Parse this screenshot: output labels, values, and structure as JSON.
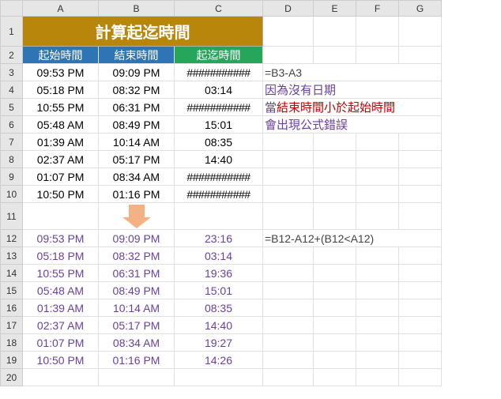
{
  "columns": [
    "",
    "A",
    "B",
    "C",
    "D",
    "E",
    "F",
    "G"
  ],
  "title": "計算起迄時間",
  "headers": {
    "start": "起始時間",
    "end": "結束時間",
    "elapsed": "起迄時間"
  },
  "rows_top": [
    {
      "n": 3,
      "a": "09:53 PM",
      "b": "09:09 PM",
      "c": "###########"
    },
    {
      "n": 4,
      "a": "05:18 PM",
      "b": "08:32 PM",
      "c": "03:14"
    },
    {
      "n": 5,
      "a": "10:55 PM",
      "b": "06:31 PM",
      "c": "###########"
    },
    {
      "n": 6,
      "a": "05:48 AM",
      "b": "08:49 PM",
      "c": "15:01"
    },
    {
      "n": 7,
      "a": "01:39 AM",
      "b": "10:14 AM",
      "c": "08:35"
    },
    {
      "n": 8,
      "a": "02:37 AM",
      "b": "05:17 PM",
      "c": "14:40"
    },
    {
      "n": 9,
      "a": "01:07 PM",
      "b": "08:34 AM",
      "c": "###########"
    },
    {
      "n": 10,
      "a": "10:50 PM",
      "b": "01:16 PM",
      "c": "###########"
    }
  ],
  "rows_bottom": [
    {
      "n": 12,
      "a": "09:53 PM",
      "b": "09:09 PM",
      "c": "23:16"
    },
    {
      "n": 13,
      "a": "05:18 PM",
      "b": "08:32 PM",
      "c": "03:14"
    },
    {
      "n": 14,
      "a": "10:55 PM",
      "b": "06:31 PM",
      "c": "19:36"
    },
    {
      "n": 15,
      "a": "05:48 AM",
      "b": "08:49 PM",
      "c": "15:01"
    },
    {
      "n": 16,
      "a": "01:39 AM",
      "b": "10:14 AM",
      "c": "08:35"
    },
    {
      "n": 17,
      "a": "02:37 AM",
      "b": "05:17 PM",
      "c": "14:40"
    },
    {
      "n": 18,
      "a": "01:07 PM",
      "b": "08:34 AM",
      "c": "19:27"
    },
    {
      "n": 19,
      "a": "10:50 PM",
      "b": "01:16 PM",
      "c": "14:26"
    }
  ],
  "formula_top": "=B3-A3",
  "formula_bottom": "=B12-A12+(B12<A12)",
  "notes": {
    "line1": "因為沒有日期",
    "line2a": "當",
    "line2b": "結束時間小於起始時間",
    "line3": "會出現公式錯誤"
  },
  "row11": 11,
  "row20": 20
}
